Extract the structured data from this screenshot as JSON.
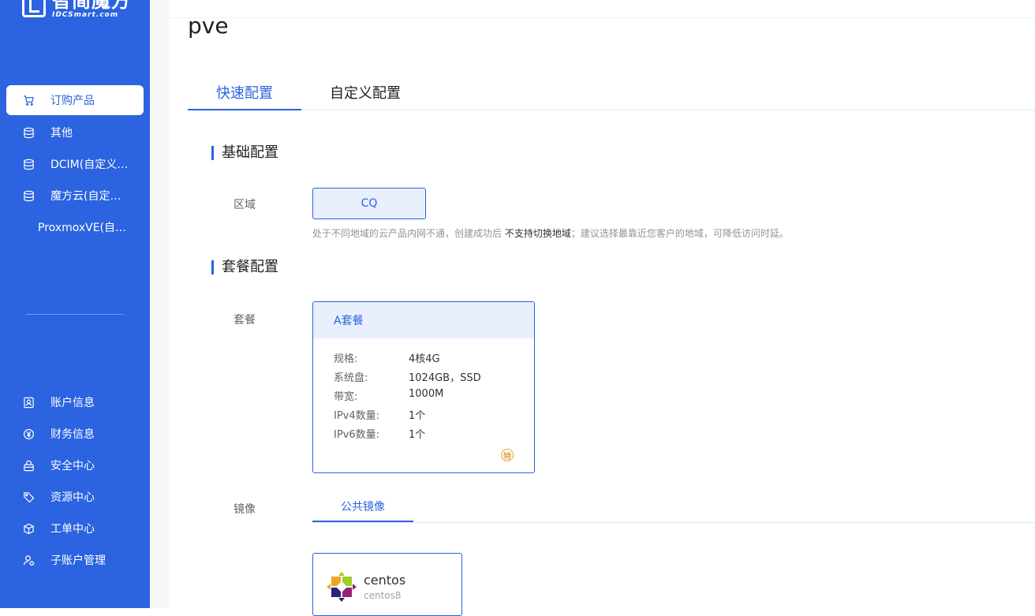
{
  "logo": {
    "cn": "智简魔方",
    "en": "IDCSmart.com"
  },
  "sidebar": {
    "top_items": [
      {
        "label": "订购产品",
        "icon": "cart-icon",
        "active": true
      },
      {
        "label": "其他",
        "icon": "database-icon"
      },
      {
        "label": "DCIM(自定义…",
        "icon": "database-icon"
      },
      {
        "label": "魔方云(自定…",
        "icon": "database-icon"
      },
      {
        "label": "ProxmoxVE(自…",
        "icon": ""
      }
    ],
    "bottom_items": [
      {
        "label": "账户信息",
        "icon": "user-card-icon"
      },
      {
        "label": "财务信息",
        "icon": "yen-icon"
      },
      {
        "label": "安全中心",
        "icon": "lock-icon"
      },
      {
        "label": "资源中心",
        "icon": "tag-icon"
      },
      {
        "label": "工单中心",
        "icon": "cube-icon"
      },
      {
        "label": "子账户管理",
        "icon": "sub-account-icon"
      }
    ]
  },
  "page": {
    "title": "pve"
  },
  "tabs": {
    "quick": "快速配置",
    "custom": "自定义配置"
  },
  "basic": {
    "section_title": "基础配置",
    "region_label": "区域",
    "region_value": "CQ",
    "hint_prefix": "处于不同地域的云产品内网不通，创建成功后",
    "hint_strong": "不支持切换地域",
    "hint_suffix": "；建议选择最靠近您客户的地域，可降低访问时延。"
  },
  "package": {
    "section_title": "套餐配置",
    "label": "套餐",
    "name": "A套餐",
    "specs": [
      {
        "k": "规格:",
        "v": "4核4G"
      },
      {
        "k": "系统盘:",
        "v": "1024GB，SSD"
      },
      {
        "k": "带宽:",
        "v": "1000M"
      },
      {
        "k": "IPv4数量:",
        "v": "1个"
      },
      {
        "k": "IPv6数量:",
        "v": "1个"
      }
    ],
    "badge": "特"
  },
  "image": {
    "label": "镜像",
    "tab_public": "公共镜像",
    "os_name": "centos",
    "os_version": "centos8"
  },
  "colors": {
    "primary": "#2b63e0",
    "primary_light": "#e8f0fd",
    "badge": "#e6a23c"
  }
}
